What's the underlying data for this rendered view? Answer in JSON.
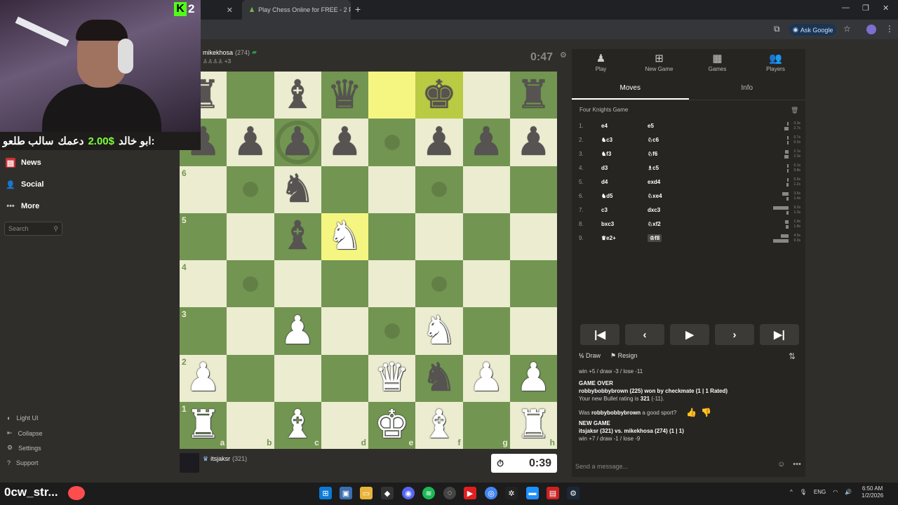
{
  "browser": {
    "tab_title": "Play Chess Online for FREE - 2 P",
    "ask_google": "Ask Google"
  },
  "stream_overlay": {
    "kick_count": "2",
    "donation_name": "ابو خالد:",
    "donation_amount": "2.00$",
    "donation_text": "دعمك",
    "donation_scroll": "سالب طلعو",
    "ticker": "0cw_str..."
  },
  "sidebar": {
    "items": [
      {
        "label": "News",
        "icon": "newspaper-icon"
      },
      {
        "label": "Social",
        "icon": "social-icon"
      },
      {
        "label": "More",
        "icon": "more-icon"
      }
    ],
    "search_placeholder": "Search",
    "bottom": [
      {
        "label": "Light UI",
        "icon": "theme-icon"
      },
      {
        "label": "Collapse",
        "icon": "collapse-icon"
      },
      {
        "label": "Settings",
        "icon": "gear-icon"
      },
      {
        "label": "Support",
        "icon": "help-icon"
      }
    ]
  },
  "top_player": {
    "name": "mikekhosa",
    "rating": "(274)",
    "captured": "+3",
    "clock": "0:47"
  },
  "bottom_player": {
    "name": "itsjaksr",
    "rating": "(321)",
    "clock": "0:39"
  },
  "board": {
    "files": [
      "a",
      "b",
      "c",
      "d",
      "e",
      "f",
      "g",
      "h"
    ],
    "ranks": [
      "8",
      "7",
      "6",
      "5",
      "4",
      "3",
      "2",
      "1"
    ],
    "rows": [
      [
        "bR",
        "",
        "bB",
        "bQ",
        "",
        "bK",
        "",
        "bR"
      ],
      [
        "bP",
        "bP",
        "bP",
        "bP",
        "",
        "bP",
        "bP",
        "bP"
      ],
      [
        "",
        "",
        "bN",
        "",
        "",
        "",
        "",
        ""
      ],
      [
        "",
        "",
        "bB",
        "wN",
        "",
        "",
        "",
        ""
      ],
      [
        "",
        "",
        "",
        "",
        "",
        "",
        "",
        ""
      ],
      [
        "",
        "",
        "wP",
        "",
        "",
        "wN",
        "",
        ""
      ],
      [
        "wP",
        "",
        "",
        "",
        "wQ",
        "bN",
        "wP",
        "wP"
      ],
      [
        "wR",
        "",
        "wB",
        "",
        "wK",
        "wB",
        "",
        "wR"
      ]
    ],
    "highlight": [
      [
        0,
        4
      ],
      [
        0,
        5
      ],
      [
        3,
        3
      ]
    ],
    "dots": [
      [
        1,
        4
      ],
      [
        2,
        1
      ],
      [
        2,
        5
      ],
      [
        4,
        1
      ],
      [
        4,
        5
      ],
      [
        5,
        4
      ]
    ],
    "rings": [
      [
        1,
        2
      ]
    ]
  },
  "panel": {
    "tabs": [
      {
        "label": "Play",
        "icon": "pawn-icon"
      },
      {
        "label": "New Game",
        "icon": "plus-icon"
      },
      {
        "label": "Games",
        "icon": "board-icon"
      },
      {
        "label": "Players",
        "icon": "players-icon"
      }
    ],
    "subtabs": [
      "Moves",
      "Info"
    ],
    "opening": "Four Knights Game",
    "moves": [
      {
        "n": "1.",
        "w": "e4",
        "b": "e5",
        "t1": "0.3s",
        "t2": "2.7s",
        "v1": 0.3,
        "v2": 2.7
      },
      {
        "n": "2.",
        "w": "♞c3",
        "b": "♘c6",
        "t1": "0.7s",
        "t2": "0.2s",
        "v1": 0.7,
        "v2": 0.2
      },
      {
        "n": "3.",
        "w": "♞f3",
        "b": "♘f6",
        "t1": "2.1s",
        "t2": "2.3s",
        "v1": 2.1,
        "v2": 2.3
      },
      {
        "n": "4.",
        "w": "d3",
        "b": "♗c5",
        "t1": "0.1s",
        "t2": "0.8s",
        "v1": 0.1,
        "v2": 0.8
      },
      {
        "n": "5.",
        "w": "d4",
        "b": "exd4",
        "t1": "0.9s",
        "t2": "1.2s",
        "v1": 0.9,
        "v2": 1.2
      },
      {
        "n": "6.",
        "w": "♞d5",
        "b": "♘xe4",
        "t1": "3.6s",
        "t2": "1.4s",
        "v1": 3.6,
        "v2": 1.4
      },
      {
        "n": "7.",
        "w": "c3",
        "b": "dxc3",
        "t1": "9.2s",
        "t2": "1.3s",
        "v1": 9.2,
        "v2": 1.3
      },
      {
        "n": "8.",
        "w": "bxc3",
        "b": "♘xf2",
        "t1": "1.9s",
        "t2": "1.8s",
        "v1": 1.9,
        "v2": 1.8
      },
      {
        "n": "9.",
        "w": "♛e2+",
        "b": "♔f8",
        "t1": "4.5s",
        "t2": "9.3s",
        "v1": 4.5,
        "v2": 9.3
      }
    ],
    "controls": [
      "first-icon",
      "prev-icon",
      "play-icon",
      "next-icon",
      "last-icon"
    ],
    "draw": "Draw",
    "resign": "Resign",
    "chat": {
      "line0": "win +5 / draw -3 / lose -11",
      "go_title": "GAME OVER",
      "go_line1": "robbybobbybrown (225) won by checkmate (1 | 1 Rated)",
      "go_line2a": "Your new Bullet rating is ",
      "go_line2b": "321",
      "go_line2c": " (-11).",
      "question_a": "Was ",
      "question_b": "robbybobbybrown",
      "question_c": " a good sport?",
      "ng_title": "NEW GAME",
      "ng_line1": "itsjaksr (321) vs. mikekhosa (274) (1 | 1)",
      "ng_line2": "win +7 / draw -1 / lose -9"
    },
    "chat_placeholder": "Send a message..."
  },
  "taskbar": {
    "lang": "ENG",
    "time": "6:50 AM",
    "date": "1/2/2026"
  }
}
